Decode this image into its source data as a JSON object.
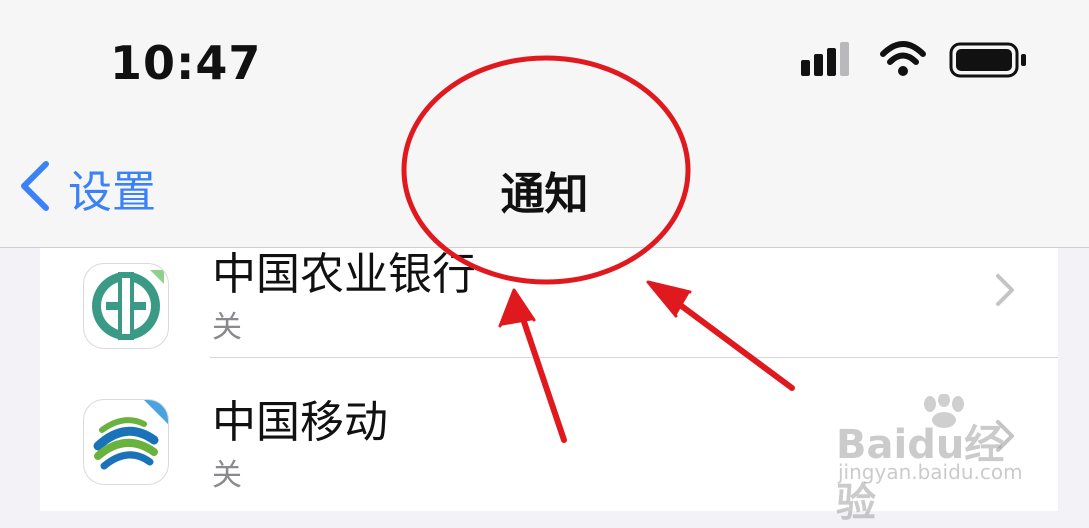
{
  "status_bar": {
    "time": "10:47",
    "icons": [
      "cellular-signal-icon",
      "wifi-icon",
      "battery-icon"
    ]
  },
  "nav": {
    "back_label": "设置",
    "title": "通知"
  },
  "list": {
    "items": [
      {
        "title": "中国农业银行",
        "subtitle": "关",
        "icon": "abc-bank-icon"
      },
      {
        "title": "中国移动",
        "subtitle": "关",
        "icon": "china-mobile-icon"
      }
    ]
  },
  "watermark": {
    "brand": "Baidu经验",
    "url": "jingyan.baidu.com"
  },
  "colors": {
    "accent": "#3b82f6",
    "annotation": "#e0191e",
    "abc_green": "#3a9a85",
    "mobile_blue": "#1a73b8",
    "mobile_green": "#6ab23e"
  }
}
